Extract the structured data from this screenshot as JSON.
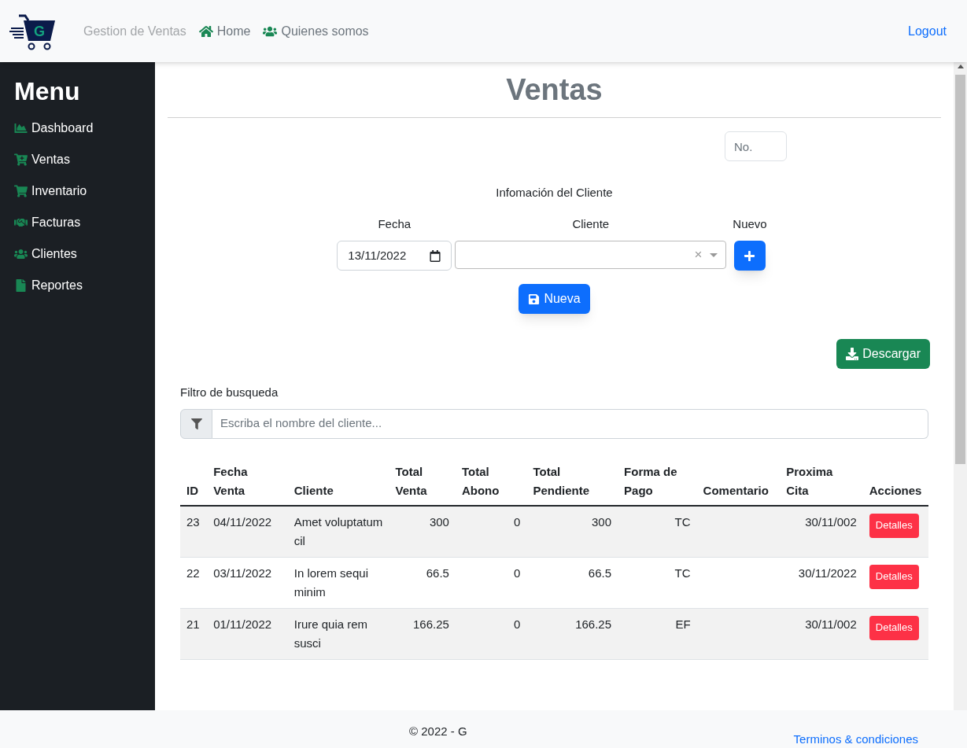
{
  "navbar": {
    "logo_letter": "G",
    "brand": "Gestion de Ventas",
    "links": [
      {
        "kind": "home",
        "label": "Home"
      },
      {
        "kind": "users",
        "label": "Quienes somos"
      }
    ],
    "logout": "Logout"
  },
  "sidebar": {
    "title": "Menu",
    "items": [
      {
        "kind": "chart",
        "label": "Dashboard"
      },
      {
        "kind": "cart-plus",
        "label": "Ventas"
      },
      {
        "kind": "cart",
        "label": "Inventario"
      },
      {
        "kind": "handshake",
        "label": "Facturas"
      },
      {
        "kind": "users",
        "label": "Clientes"
      },
      {
        "kind": "file",
        "label": "Reportes"
      }
    ]
  },
  "page": {
    "title": "Ventas",
    "number_field": {
      "placeholder": "No."
    },
    "section_title": "Infomación del Cliente",
    "fecha": {
      "label": "Fecha",
      "value": "13/11/2022"
    },
    "cliente": {
      "label": "Cliente",
      "clear": "×"
    },
    "nuevo": {
      "label": "Nuevo"
    },
    "save_button": "Nueva",
    "download_button": "Descargar",
    "filter": {
      "label": "Filtro de busqueda",
      "placeholder": "Escriba el nombre del cliente..."
    }
  },
  "table": {
    "columns": [
      {
        "label": "ID"
      },
      {
        "label": "Fecha Venta"
      },
      {
        "label": "Cliente"
      },
      {
        "label": "Total Venta"
      },
      {
        "label": "Total Abono"
      },
      {
        "label": "Total Pendiente"
      },
      {
        "label": "Forma de Pago"
      },
      {
        "label": "Comentario"
      },
      {
        "label": "Proxima Cita"
      },
      {
        "label": "Acciones"
      }
    ],
    "rows": [
      {
        "cells": [
          "23",
          "04/11/2022",
          "Amet voluptatum cil",
          "300",
          "0",
          "300",
          "TC",
          "",
          "30/11/002"
        ],
        "action": "Detalles"
      },
      {
        "cells": [
          "22",
          "03/11/2022",
          "In lorem sequi minim",
          "66.5",
          "0",
          "66.5",
          "TC",
          "",
          "30/11/2022"
        ],
        "action": "Detalles"
      },
      {
        "cells": [
          "21",
          "01/11/2022",
          "Irure quia rem susci",
          "166.25",
          "0",
          "166.25",
          "EF",
          "",
          "30/11/002"
        ],
        "action": "Detalles"
      }
    ]
  },
  "footer": {
    "copyright": "© 2022 - G",
    "link": "Terminos & condiciones"
  }
}
